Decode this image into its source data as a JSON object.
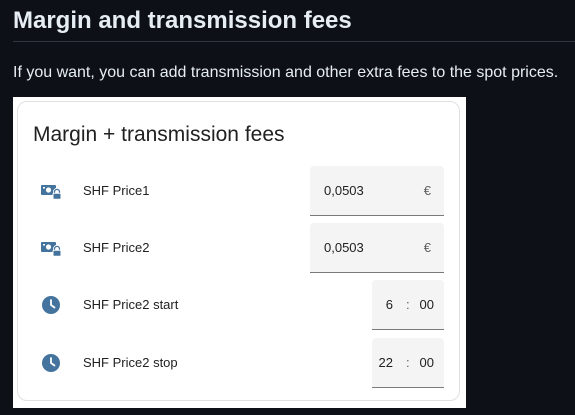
{
  "section": {
    "title": "Margin and transmission fees",
    "description": "If you want, you can add transmission and other extra fees to the spot prices."
  },
  "card": {
    "title": "Margin + transmission fees",
    "rows": [
      {
        "label": "SHF Price1",
        "value": "0,0503",
        "unit": "€",
        "icon": "cash-lock-icon"
      },
      {
        "label": "SHF Price2",
        "value": "0,0503",
        "unit": "€",
        "icon": "cash-lock-icon"
      },
      {
        "label": "SHF Price2 start",
        "hour": "6",
        "separator": ":",
        "minute": "00",
        "icon": "clock-icon"
      },
      {
        "label": "SHF Price2 stop",
        "hour": "22",
        "separator": ":",
        "minute": "00",
        "icon": "clock-icon"
      }
    ]
  },
  "colors": {
    "page_background": "#0d1117",
    "page_text": "#e6edf3",
    "icon": "#44739e",
    "field_background": "#f4f4f4"
  }
}
